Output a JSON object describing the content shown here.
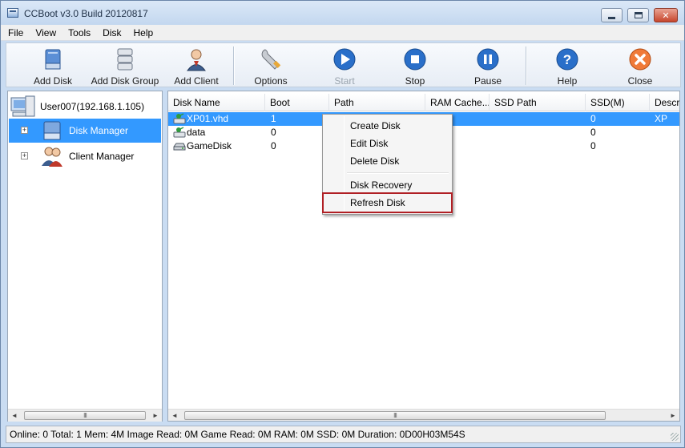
{
  "window": {
    "title": "CCBoot v3.0 Build 20120817",
    "controls": {
      "minimize": "minimize-icon",
      "maximize": "maximize-icon",
      "close": "close-icon"
    }
  },
  "menubar": {
    "items": [
      "File",
      "View",
      "Tools",
      "Disk",
      "Help"
    ]
  },
  "toolbar": {
    "add_disk": "Add Disk",
    "add_disk_group": "Add Disk Group",
    "add_client": "Add Client",
    "options": "Options",
    "start": "Start",
    "stop": "Stop",
    "pause": "Pause",
    "help": "Help",
    "close": "Close",
    "start_disabled": true
  },
  "tree": {
    "root": "User007(192.168.1.105)",
    "items": [
      {
        "label": "Disk Manager",
        "selected": true,
        "expander": "+"
      },
      {
        "label": "Client Manager",
        "selected": false,
        "expander": "+"
      }
    ]
  },
  "grid": {
    "columns": [
      "Disk Name",
      "Boot",
      "Path",
      "RAM Cache...",
      "SSD Path",
      "SSD(M)",
      "Descri"
    ],
    "rows": [
      {
        "name": "XP01.vhd",
        "boot": "1",
        "ssd": "0",
        "desc": "XP",
        "selected": true
      },
      {
        "name": "data",
        "boot": "0",
        "ssd": "0",
        "desc": "",
        "selected": false
      },
      {
        "name": "GameDisk",
        "boot": "0",
        "ssd": "0",
        "desc": "",
        "selected": false
      }
    ]
  },
  "context_menu": {
    "items": [
      "Create Disk",
      "Edit Disk",
      "Delete Disk",
      "Disk Recovery",
      "Refresh Disk"
    ],
    "highlighted": "Refresh Disk"
  },
  "scrollbar": {
    "left_arrow": "◄",
    "right_arrow": "►",
    "thumb_grip": "III"
  },
  "status": "Online: 0 Total: 1 Mem: 4M Image Read: 0M Game Read: 0M RAM: 0M SSD: 0M Duration: 0D00H03M54S",
  "colors": {
    "selection": "#3399ff",
    "highlight_border": "#b01f24",
    "chrome": "#c9dcf2"
  }
}
